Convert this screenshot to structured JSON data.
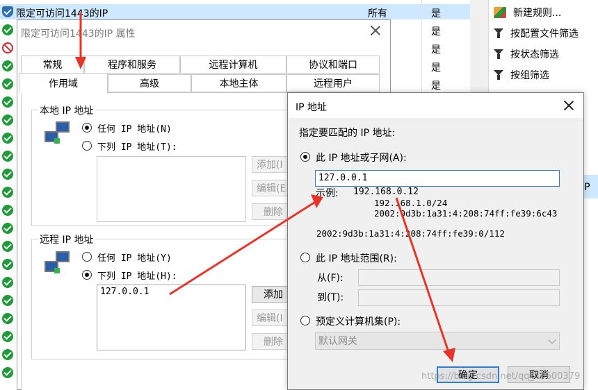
{
  "rule_list": {
    "first_rule": {
      "name": "限定可访问1443的IP",
      "scope": "所有",
      "enabled": "是"
    },
    "enabled_values": [
      "是",
      "是",
      "是",
      "是",
      "是"
    ]
  },
  "actions": {
    "items": [
      "新建规则...",
      "按配置文件筛选",
      "按状态筛选",
      "按组筛选"
    ],
    "ip_fragment": "IP"
  },
  "props_dialog": {
    "title": "限定可访问1443的IP 属性",
    "tabs_top": [
      "常规",
      "程序和服务",
      "远程计算机",
      "协议和端口"
    ],
    "tabs_bottom": [
      "作用域",
      "高级",
      "本地主体",
      "远程用户"
    ],
    "local_group": {
      "label": "本地 IP 地址",
      "any_option": "任何 IP 地址(N)",
      "list_option": "下列 IP 地址(T):",
      "add_btn": "添加(I",
      "edit_btn": "编辑(E",
      "remove_btn": "删除"
    },
    "remote_group": {
      "label": "远程 IP 地址",
      "any_option": "任何 IP 地址(Y)",
      "list_option": "下列 IP 地址(H):",
      "entry": "127.0.0.1",
      "add_btn": "添加",
      "edit_btn": "编辑(I",
      "remove_btn": "删除"
    }
  },
  "ip_dialog": {
    "title": "IP 地址",
    "prompt": "指定要匹配的 IP 地址:",
    "option_subnet": "此 IP 地址或子网(A):",
    "input_value": "127.0.0.1",
    "example_label": "示例:",
    "examples": [
      "192.168.0.12",
      "192.168.1.0/24",
      "2002:9d3b:1a31:4:208:74ff:fe39:6c43",
      "2002:9d3b:1a31:4:208:74ff:fe39:0/112"
    ],
    "option_range": "此 IP 地址范围(R):",
    "from_label": "从(F):",
    "to_label": "到(T):",
    "option_predefined": "预定义计算机集(P):",
    "predefined_value": "默认网关",
    "ok": "确定",
    "cancel": "取消"
  },
  "watermark": "https://blog.csdn.net/qq_40600379",
  "colors": {
    "arrow": "#e8352a",
    "selection": "#cde8ff",
    "focus": "#2f7bd6"
  }
}
